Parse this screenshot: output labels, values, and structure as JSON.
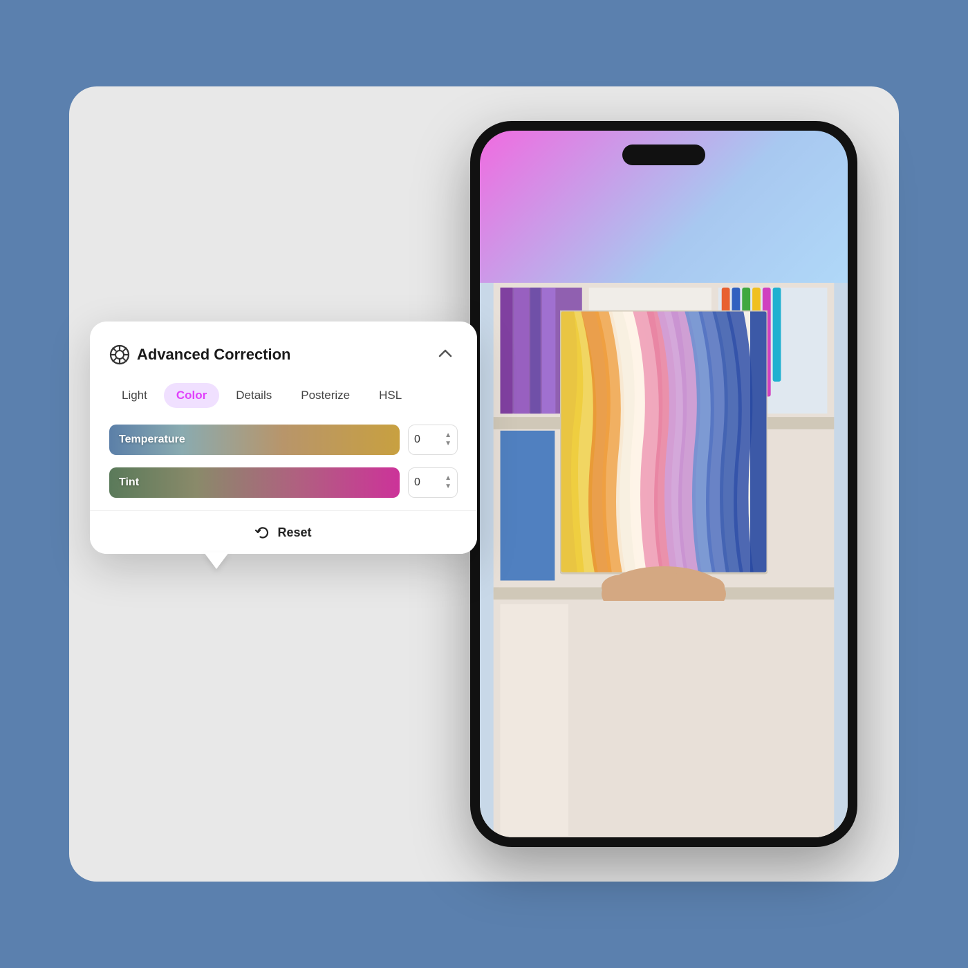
{
  "background_color": "#5b80ae",
  "card_background": "#e8e8e8",
  "panel": {
    "title": "Advanced Correction",
    "icon_name": "advanced-correction-icon",
    "tabs": [
      {
        "id": "light",
        "label": "Light",
        "active": false
      },
      {
        "id": "color",
        "label": "Color",
        "active": true
      },
      {
        "id": "details",
        "label": "Details",
        "active": false
      },
      {
        "id": "posterize",
        "label": "Posterize",
        "active": false
      },
      {
        "id": "hsl",
        "label": "HSL",
        "active": false
      }
    ],
    "sliders": [
      {
        "id": "temperature",
        "label": "Temperature",
        "value": "0",
        "track_type": "temperature"
      },
      {
        "id": "tint",
        "label": "Tint",
        "value": "0",
        "track_type": "tint"
      }
    ],
    "reset_button_label": "Reset",
    "reset_icon": "↺"
  }
}
